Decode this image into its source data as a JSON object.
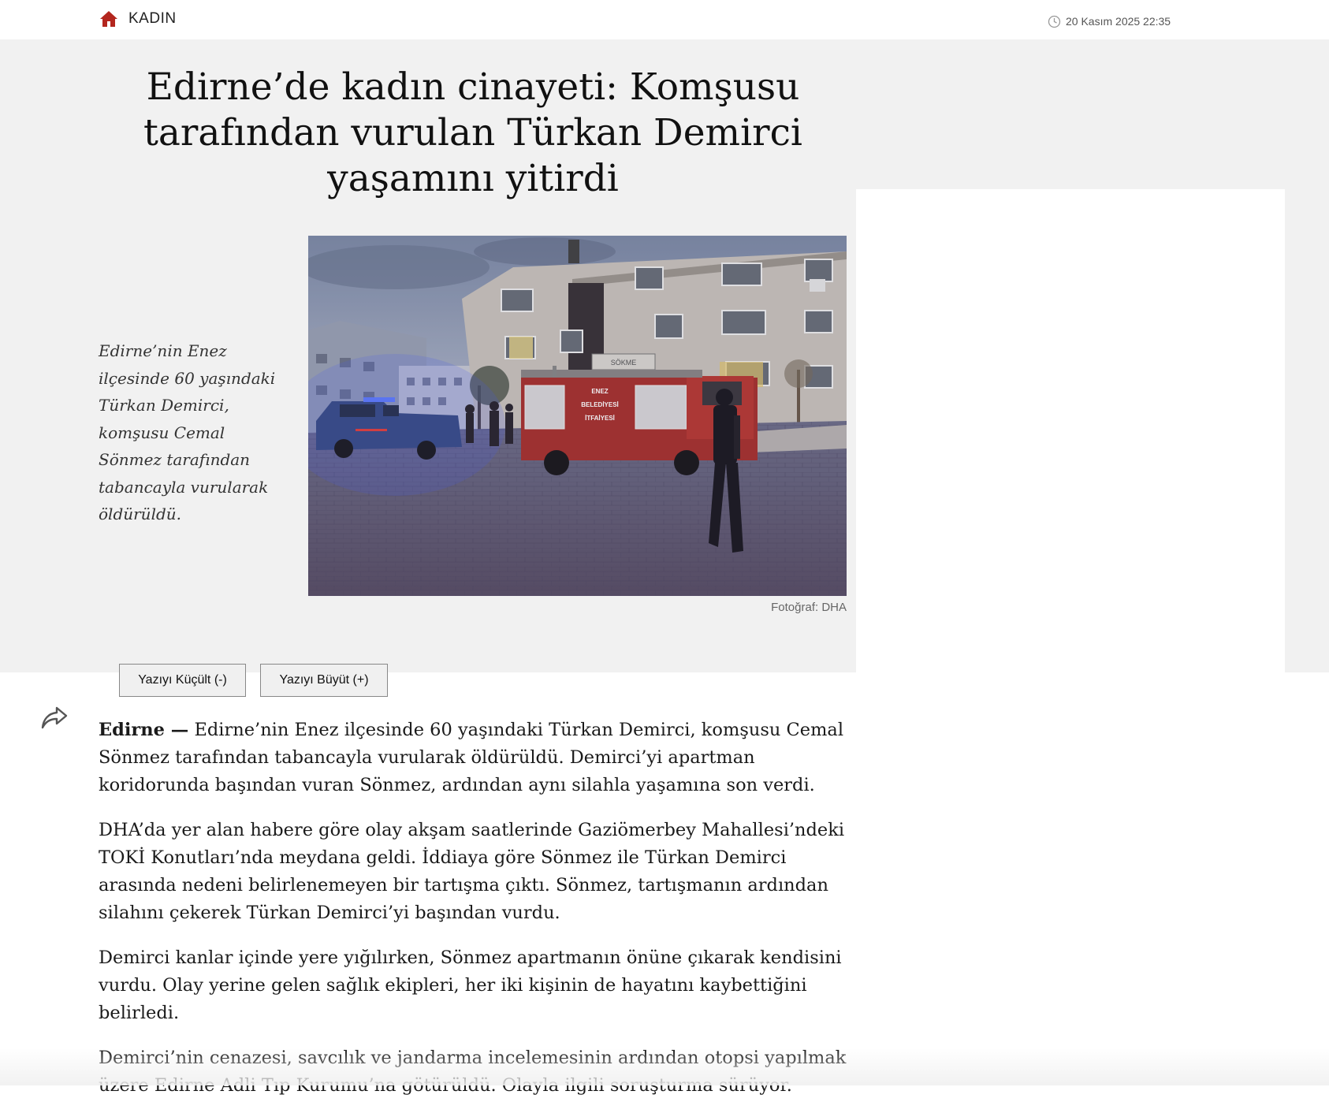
{
  "header": {
    "section": "KADIN",
    "timestamp": "20 Kasım 2025 22:35",
    "home_icon": "home-icon",
    "clock_icon": "clock-icon",
    "accent_color": "#b3261e"
  },
  "article": {
    "headline": "Edirne’de kadın cinayeti: Komşusu tarafından vurulan Türkan Demirci yaşamını yitirdi",
    "caption": "Edirne’nin Enez ilçesinde 60 yaşındaki Türkan Demirci, komşusu Cemal Sönmez tarafından tabancayla vurularak öldürüldü.",
    "photo_credit": "Fotoğraf: DHA",
    "photo_truck_text": [
      "ENEZ",
      "BELEDİYESİ",
      "İTFAİYESİ"
    ],
    "photo_building_sign": "SÖKME",
    "dateline": "Edirne —",
    "paragraphs": [
      "Edirne’nin Enez ilçesinde 60 yaşındaki Türkan Demirci, komşusu Cemal Sönmez tarafından tabancayla vurularak öldürüldü. Demirci’yi apartman koridorunda başından vuran Sönmez, ardından aynı silahla yaşamına son verdi.",
      "DHA’da yer alan habere göre olay akşam saatlerinde Gaziömerbey Mahallesi’ndeki TOKİ Konutları’nda meydana geldi. İddiaya göre Sönmez ile Türkan Demirci arasında nedeni belirlenemeyen bir tartışma çıktı. Sönmez, tartışmanın ardından silahını çekerek Türkan Demirci’yi başından vurdu.",
      "Demirci kanlar içinde yere yığılırken, Sönmez apartmanın önüne çıkarak kendisini vurdu. Olay yerine gelen sağlık ekipleri, her iki kişinin de hayatını kaybettiğini belirledi.",
      "Demirci’nin cenazesi, savcılık ve jandarma incelemesinin ardından otopsi yapılmak üzere Edirne Adli Tıp Kurumu’na götürüldü. Olayla ilgili soruşturma sürüyor."
    ]
  },
  "controls": {
    "shrink_label": "Yazıyı Küçült (-)",
    "enlarge_label": "Yazıyı Büyüt (+)",
    "share_icon": "share-icon"
  }
}
